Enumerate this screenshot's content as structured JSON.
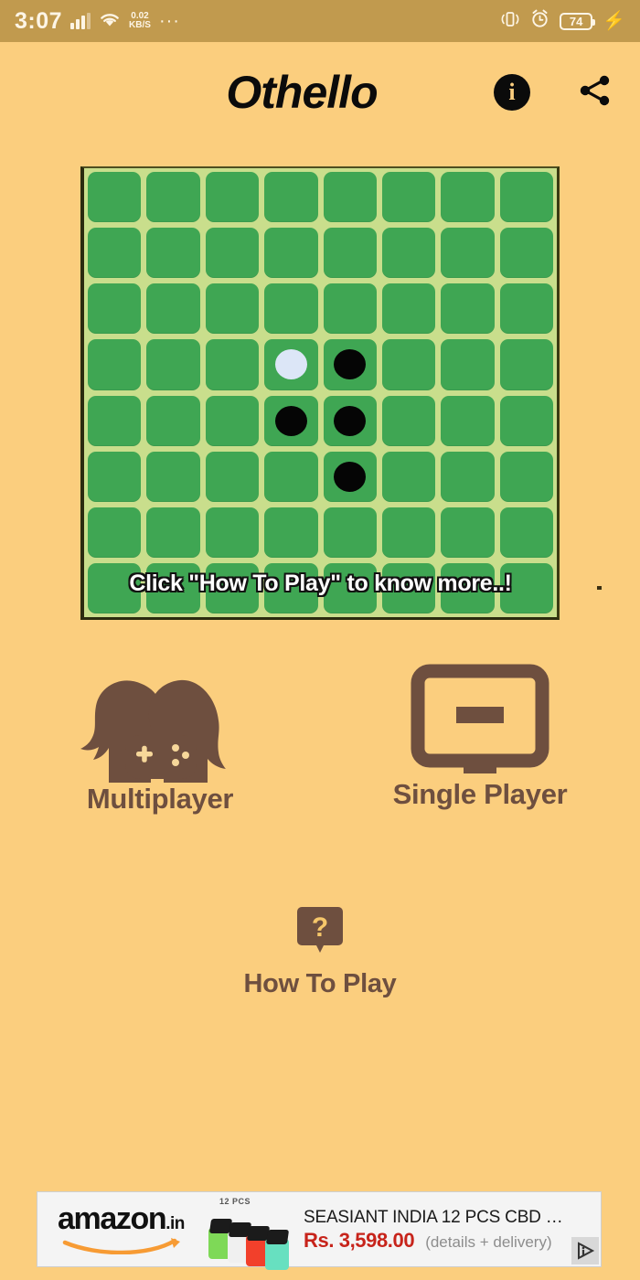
{
  "status_bar": {
    "time": "3:07",
    "network_speed_value": "0.02",
    "network_speed_unit": "KB/S",
    "overflow": "···",
    "battery_level": "74",
    "icons": [
      "signal-icon",
      "wifi-icon",
      "vibrate-icon",
      "alarm-icon",
      "battery-icon",
      "charging-bolt-icon"
    ]
  },
  "app_bar": {
    "title": "Othello",
    "info_glyph": "i",
    "info_label": "Info",
    "share_label": "Share"
  },
  "board": {
    "rows": 8,
    "cols": 8,
    "cell_color": "#3FA653",
    "grid_color": "#C9DE8C",
    "black_color": "#050505",
    "white_color": "#DCE6F7",
    "caption": "Click \"How To Play\" to know more..!",
    "cells": [
      [
        "",
        "",
        "",
        "",
        "",
        "",
        "",
        ""
      ],
      [
        "",
        "",
        "",
        "",
        "",
        "",
        "",
        ""
      ],
      [
        "",
        "",
        "",
        "",
        "",
        "",
        "",
        ""
      ],
      [
        "",
        "",
        "",
        "white",
        "black",
        "",
        "",
        ""
      ],
      [
        "",
        "",
        "",
        "black",
        "black",
        "",
        "",
        ""
      ],
      [
        "",
        "",
        "",
        "",
        "black",
        "",
        "",
        ""
      ],
      [
        "",
        "",
        "",
        "",
        "",
        "",
        "",
        ""
      ],
      [
        "",
        "",
        "",
        "",
        "",
        "",
        "",
        ""
      ]
    ]
  },
  "menu": {
    "multiplayer_label": "Multiplayer",
    "multiplayer_icon": "two-players-gamepad-icon",
    "single_player_label": "Single Player",
    "single_player_icon": "monitor-icon",
    "how_to_play_label": "How To Play",
    "how_to_play_icon": "question-bubble-icon",
    "icon_color": "#6E4F3F"
  },
  "ad": {
    "brand": "amazon",
    "brand_tld": ".in",
    "product_caption": "12 PCS",
    "title": "SEASIANT INDIA 12 PCS CBD …",
    "price": "Rs. 3,598.00",
    "details": "(details + delivery)",
    "price_color": "#C7241B",
    "adchoices_label": "AdChoices"
  },
  "theme": {
    "background": "#FBCE7E",
    "status_bar_background": "#C19A4E",
    "text_brown": "#6E4F3F"
  }
}
